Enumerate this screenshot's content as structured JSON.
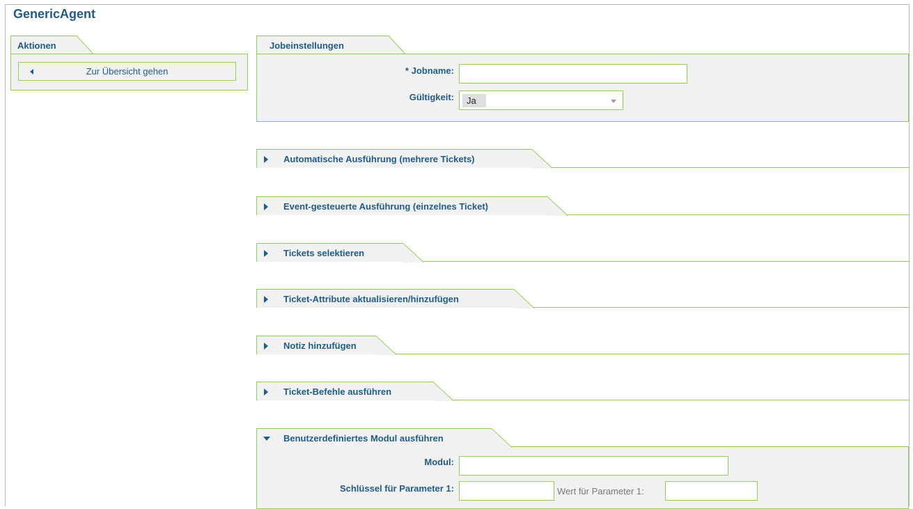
{
  "header": {
    "title": "GenericAgent"
  },
  "sidebar": {
    "tab_label": "Aktionen",
    "back_button_label": "Zur Übersicht gehen"
  },
  "job_settings": {
    "tab_label": "Jobeinstellungen",
    "jobname_label": "* Jobname:",
    "jobname_value": "",
    "validity_label": "Gültigkeit:",
    "validity_value": "Ja"
  },
  "sections": [
    {
      "label": "Automatische Ausführung (mehrere Tickets)",
      "expanded": false
    },
    {
      "label": "Event-gesteuerte Ausführung (einzelnes Ticket)",
      "expanded": false
    },
    {
      "label": "Tickets selektieren",
      "expanded": false
    },
    {
      "label": "Ticket-Attribute aktualisieren/hinzufügen",
      "expanded": false
    },
    {
      "label": "Notiz hinzufügen",
      "expanded": false
    },
    {
      "label": "Ticket-Befehle ausführen",
      "expanded": false
    },
    {
      "label": "Benutzerdefiniertes Modul ausführen",
      "expanded": true
    }
  ],
  "custom_module": {
    "module_label": "Modul:",
    "module_value": "",
    "param1_key_label": "Schlüssel für Parameter 1:",
    "param1_key_value": "",
    "param1_value_label": "Wert für Parameter 1:",
    "param1_value_value": ""
  },
  "colors": {
    "accent_green": "#8fd14f",
    "text_blue": "#1f5c8a",
    "panel_gray": "#f1f1f1"
  }
}
